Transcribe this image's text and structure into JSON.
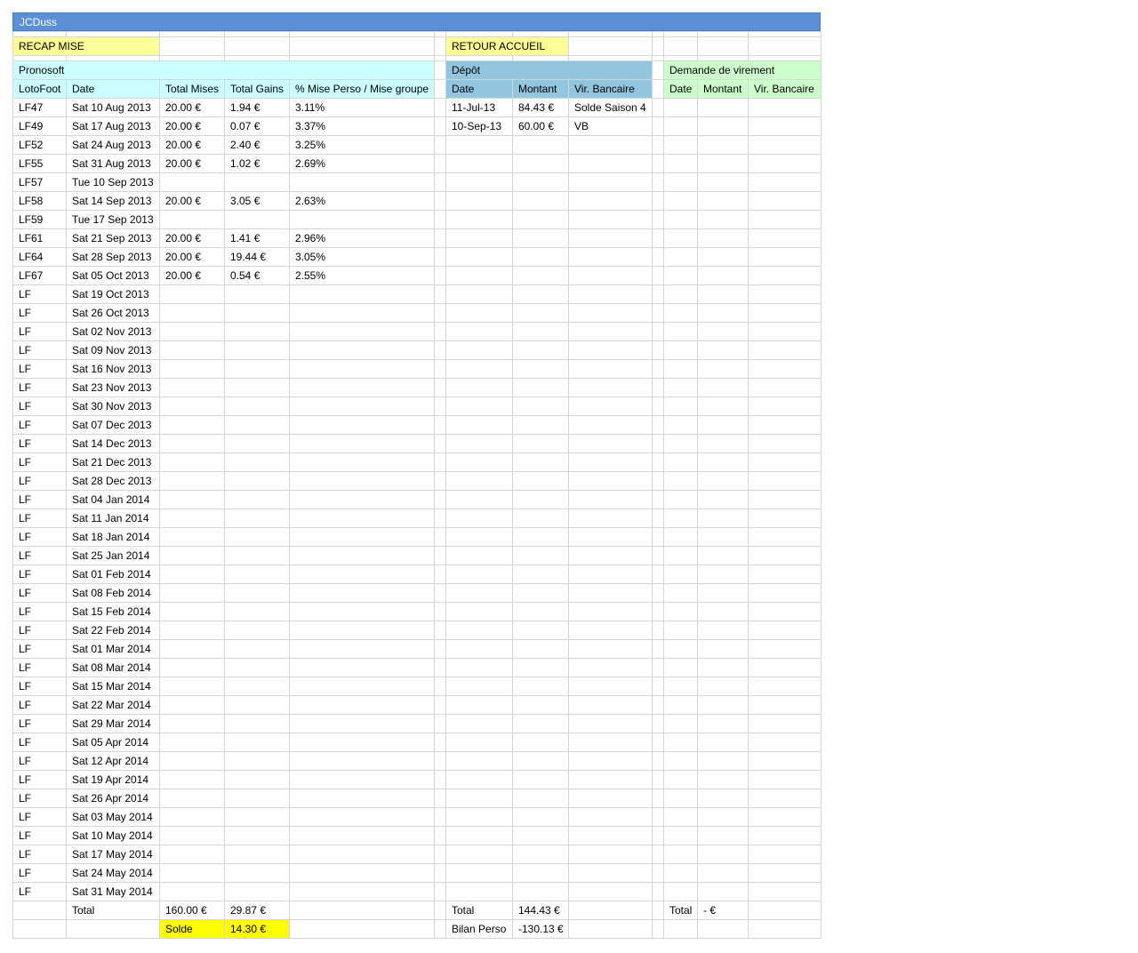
{
  "app_title": "JCDuss",
  "recap_label": "RECAP MISE",
  "retour_label": "RETOUR ACCUEIL",
  "sections": {
    "pronosoft": "Pronosoft",
    "depot": "Dépôt",
    "demande": "Demande de virement"
  },
  "headers": {
    "pronosoft": [
      "LotoFoot",
      "Date",
      "Total Mises",
      "Total Gains",
      "% Mise Perso / Mise groupe"
    ],
    "depot": [
      "Date",
      "Montant",
      "Vir. Bancaire"
    ],
    "demande": [
      "Date",
      "Montant",
      "Vir. Bancaire"
    ]
  },
  "rows": [
    [
      "LF47",
      "Sat 10 Aug 2013",
      "20.00 €",
      "1.94 €",
      "3.11%"
    ],
    [
      "LF49",
      "Sat 17 Aug 2013",
      "20.00 €",
      "0.07 €",
      "3.37%"
    ],
    [
      "LF52",
      "Sat 24 Aug 2013",
      "20.00 €",
      "2.40 €",
      "3.25%"
    ],
    [
      "LF55",
      "Sat 31 Aug 2013",
      "20.00 €",
      "1.02 €",
      "2.69%"
    ],
    [
      "LF57",
      "Tue 10 Sep 2013",
      "",
      "",
      ""
    ],
    [
      "LF58",
      "Sat 14 Sep 2013",
      "20.00 €",
      "3.05 €",
      "2.63%"
    ],
    [
      "LF59",
      "Tue 17 Sep 2013",
      "",
      "",
      ""
    ],
    [
      "LF61",
      "Sat 21 Sep 2013",
      "20.00 €",
      "1.41 €",
      "2.96%"
    ],
    [
      "LF64",
      "Sat 28 Sep 2013",
      "20.00 €",
      "19.44 €",
      "3.05%"
    ],
    [
      "LF67",
      "Sat 05 Oct 2013",
      "20.00 €",
      "0.54 €",
      "2.55%"
    ],
    [
      "LF",
      "Sat 19 Oct 2013",
      "",
      "",
      ""
    ],
    [
      "LF",
      "Sat 26 Oct 2013",
      "",
      "",
      ""
    ],
    [
      "LF",
      "Sat 02 Nov 2013",
      "",
      "",
      ""
    ],
    [
      "LF",
      "Sat 09 Nov 2013",
      "",
      "",
      ""
    ],
    [
      "LF",
      "Sat 16 Nov 2013",
      "",
      "",
      ""
    ],
    [
      "LF",
      "Sat 23 Nov 2013",
      "",
      "",
      ""
    ],
    [
      "LF",
      "Sat 30 Nov 2013",
      "",
      "",
      ""
    ],
    [
      "LF",
      "Sat 07 Dec 2013",
      "",
      "",
      ""
    ],
    [
      "LF",
      "Sat 14 Dec 2013",
      "",
      "",
      ""
    ],
    [
      "LF",
      "Sat 21 Dec 2013",
      "",
      "",
      ""
    ],
    [
      "LF",
      "Sat 28 Dec 2013",
      "",
      "",
      ""
    ],
    [
      "LF",
      "Sat 04 Jan 2014",
      "",
      "",
      ""
    ],
    [
      "LF",
      "Sat 11 Jan 2014",
      "",
      "",
      ""
    ],
    [
      "LF",
      "Sat 18 Jan 2014",
      "",
      "",
      ""
    ],
    [
      "LF",
      "Sat 25 Jan 2014",
      "",
      "",
      ""
    ],
    [
      "LF",
      "Sat 01 Feb 2014",
      "",
      "",
      ""
    ],
    [
      "LF",
      "Sat 08 Feb 2014",
      "",
      "",
      ""
    ],
    [
      "LF",
      "Sat 15 Feb 2014",
      "",
      "",
      ""
    ],
    [
      "LF",
      "Sat 22 Feb 2014",
      "",
      "",
      ""
    ],
    [
      "LF",
      "Sat 01 Mar 2014",
      "",
      "",
      ""
    ],
    [
      "LF",
      "Sat 08 Mar 2014",
      "",
      "",
      ""
    ],
    [
      "LF",
      "Sat 15 Mar 2014",
      "",
      "",
      ""
    ],
    [
      "LF",
      "Sat 22 Mar 2014",
      "",
      "",
      ""
    ],
    [
      "LF",
      "Sat 29 Mar 2014",
      "",
      "",
      ""
    ],
    [
      "LF",
      "Sat 05 Apr 2014",
      "",
      "",
      ""
    ],
    [
      "LF",
      "Sat 12 Apr 2014",
      "",
      "",
      ""
    ],
    [
      "LF",
      "Sat 19 Apr 2014",
      "",
      "",
      ""
    ],
    [
      "LF",
      "Sat 26 Apr 2014",
      "",
      "",
      ""
    ],
    [
      "LF",
      "Sat 03 May 2014",
      "",
      "",
      ""
    ],
    [
      "LF",
      "Sat 10 May 2014",
      "",
      "",
      ""
    ],
    [
      "LF",
      "Sat 17 May 2014",
      "",
      "",
      ""
    ],
    [
      "LF",
      "Sat 24 May 2014",
      "",
      "",
      ""
    ],
    [
      "LF",
      "Sat 31 May 2014",
      "",
      "",
      ""
    ]
  ],
  "depot_rows": [
    [
      "11-Jul-13",
      "84.43 €",
      "Solde Saison 4"
    ],
    [
      "10-Sep-13",
      "60.00 €",
      "VB"
    ]
  ],
  "totals": {
    "label": "Total",
    "mises": "160.00 €",
    "gains": "29.87 €",
    "solde_label": "Solde",
    "solde_value": "14.30 €",
    "depot_label": "Total",
    "depot_total": "144.43 €",
    "bilan_label": "Bilan Perso",
    "bilan_value": "-130.13 €",
    "demande_label": "Total",
    "demande_total": "- €"
  }
}
